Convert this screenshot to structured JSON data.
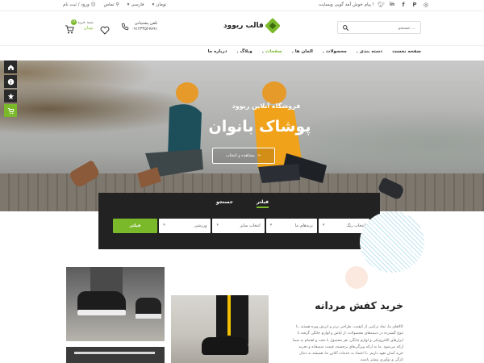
{
  "topbar": {
    "welcome": "پیام خوش آمد گویی وبسایت !",
    "language": "فارسی",
    "currency": "تومان",
    "contact": "تماس",
    "auth": "ورود / ثبت نام",
    "socials": [
      "twitter-icon",
      "linkedin-icon",
      "facebook-icon",
      "pinterest-icon",
      "instagram-icon"
    ]
  },
  "header": {
    "logo_text": "قالب ریوود",
    "search_placeholder": "جستجو ...",
    "phone_label": "تلفن پشتیبانی",
    "phone_number": "۰۹۱۲۳۴۵۶۷۸۹۱",
    "cart_label": "سبد خرید",
    "cart_price": "۰ تومان",
    "cart_count": "0"
  },
  "nav": {
    "items": [
      {
        "label": "صفحه نخست",
        "dropdown": false,
        "active": false
      },
      {
        "label": "دسته بندی",
        "dropdown": true,
        "active": false
      },
      {
        "label": "محصولات",
        "dropdown": true,
        "active": false
      },
      {
        "label": "المان ها",
        "dropdown": true,
        "active": false
      },
      {
        "label": "صفحات",
        "dropdown": true,
        "active": true
      },
      {
        "label": "وبلاگ",
        "dropdown": true,
        "active": false
      },
      {
        "label": "درباره ما",
        "dropdown": false,
        "active": false
      }
    ]
  },
  "hero": {
    "subtitle": "فروشگاه آنلاین ریوود",
    "title": "پوشاک بانوان",
    "button": "مشاهده و انتخاب"
  },
  "filter": {
    "tabs": [
      {
        "label": "فیلتر",
        "active": true
      },
      {
        "label": "جستجو",
        "active": false
      }
    ],
    "selects": [
      "انتخاب رنگ",
      "برندهای ما",
      "انتخاب سایز",
      "ورزشی"
    ],
    "button": "فیلتر"
  },
  "section": {
    "title": "خرید کفش مردانه",
    "description": "کالاهای ما، تماد ترکیبی از کیفیت، طراحی برتر و ارزش ویژه هستند. با تنوع گسترده در دسته‌های محصولات، از لباس و لوازم خانگی گرفته تا ابزارهای الکترونیکی و لوازم جانگی، هر محصول با دقت و اهتمام به شما ارائه می‌شود. ما به ارائه ویژگی‌های برجسته، قیمت منصفانه و تجربه خرید آسان تعهد داریم. با اعتماد به خدمات آنلاین ما، همیشه به دنبال تازگی و نوآوری بیشتر باشید."
  }
}
